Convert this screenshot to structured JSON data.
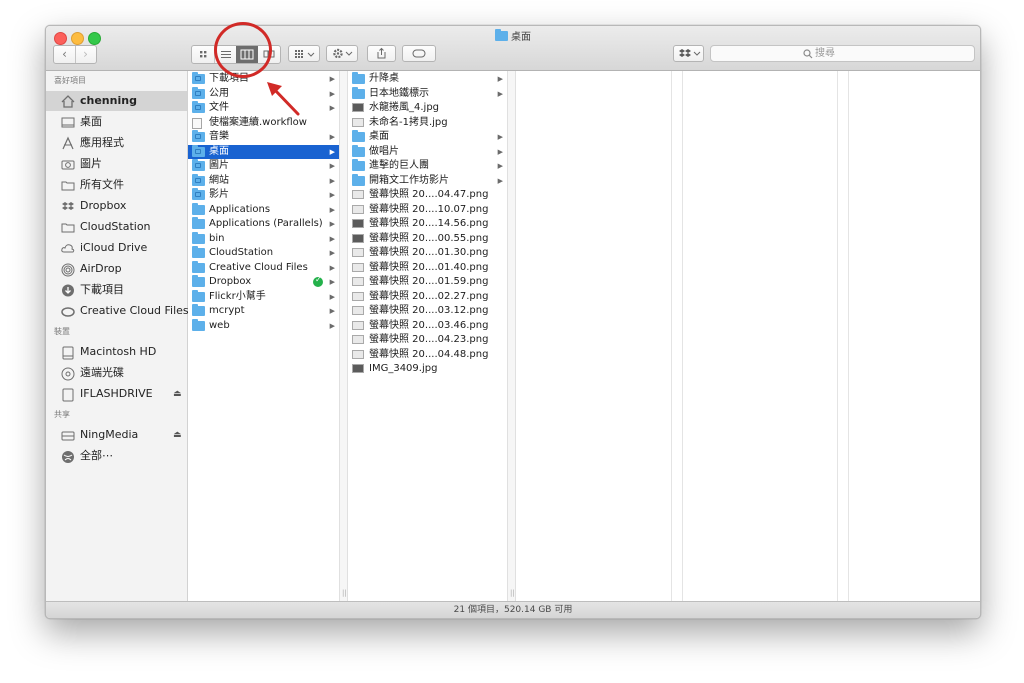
{
  "window": {
    "title": "桌面"
  },
  "toolbar": {
    "search_placeholder": "搜尋"
  },
  "sidebar": {
    "sections": [
      {
        "header": "喜好項目",
        "items": [
          {
            "label": "chenning",
            "icon": "home-icon",
            "selected": true
          },
          {
            "label": "桌面",
            "icon": "desktop-icon"
          },
          {
            "label": "應用程式",
            "icon": "applications-icon"
          },
          {
            "label": "圖片",
            "icon": "camera-icon"
          },
          {
            "label": "所有文件",
            "icon": "folder-icon"
          },
          {
            "label": "Dropbox",
            "icon": "dropbox-icon"
          },
          {
            "label": "CloudStation",
            "icon": "folder-icon"
          },
          {
            "label": "iCloud Drive",
            "icon": "cloud-icon"
          },
          {
            "label": "AirDrop",
            "icon": "airdrop-icon"
          },
          {
            "label": "下載項目",
            "icon": "download-icon"
          },
          {
            "label": "Creative Cloud Files",
            "icon": "creative-cloud-icon"
          }
        ]
      },
      {
        "header": "裝置",
        "items": [
          {
            "label": "Macintosh HD",
            "icon": "hard-drive-icon"
          },
          {
            "label": "遠端光碟",
            "icon": "disc-icon"
          },
          {
            "label": "IFLASHDRIVE",
            "icon": "usb-drive-icon",
            "eject": "⏏"
          }
        ]
      },
      {
        "header": "共享",
        "items": [
          {
            "label": "NingMedia",
            "icon": "network-server-icon",
            "eject": "⏏"
          },
          {
            "label": "全部⋯",
            "icon": "network-globe-icon"
          }
        ]
      }
    ]
  },
  "column1": [
    {
      "name": "下載項目",
      "icon": "folder-badge",
      "arrow": true
    },
    {
      "name": "公用",
      "icon": "folder-badge",
      "arrow": true
    },
    {
      "name": "文件",
      "icon": "folder-badge",
      "arrow": true
    },
    {
      "name": "使檔案連續.workflow",
      "icon": "doc",
      "arrow": false
    },
    {
      "name": "音樂",
      "icon": "folder-badge",
      "arrow": true
    },
    {
      "name": "桌面",
      "icon": "folder-badge",
      "arrow": true,
      "selected": true
    },
    {
      "name": "圖片",
      "icon": "folder-badge",
      "arrow": true
    },
    {
      "name": "網站",
      "icon": "folder-badge",
      "arrow": true
    },
    {
      "name": "影片",
      "icon": "folder-badge",
      "arrow": true
    },
    {
      "name": "Applications",
      "icon": "folder",
      "arrow": true
    },
    {
      "name": "Applications (Parallels)",
      "icon": "folder",
      "arrow": true
    },
    {
      "name": "bin",
      "icon": "folder",
      "arrow": true
    },
    {
      "name": "CloudStation",
      "icon": "folder",
      "arrow": true
    },
    {
      "name": "Creative Cloud Files",
      "icon": "folder",
      "arrow": true
    },
    {
      "name": "Dropbox",
      "icon": "folder",
      "arrow": true,
      "synced": true
    },
    {
      "name": "Flickr小幫手",
      "icon": "folder",
      "arrow": true
    },
    {
      "name": "mcrypt",
      "icon": "folder",
      "arrow": true
    },
    {
      "name": "web",
      "icon": "folder",
      "arrow": true
    }
  ],
  "column2": [
    {
      "name": "升降桌",
      "icon": "folder",
      "arrow": true
    },
    {
      "name": "日本地鐵標示",
      "icon": "folder",
      "arrow": true
    },
    {
      "name": "水龍捲風_4.jpg",
      "icon": "shot-dark",
      "arrow": false
    },
    {
      "name": "未命名-1拷貝.jpg",
      "icon": "shot",
      "arrow": false
    },
    {
      "name": "桌面",
      "icon": "folder",
      "arrow": true
    },
    {
      "name": "做唱片",
      "icon": "folder",
      "arrow": true
    },
    {
      "name": "進擊的巨人團",
      "icon": "folder",
      "arrow": true
    },
    {
      "name": "開箱文工作坊影片",
      "icon": "folder",
      "arrow": true
    },
    {
      "name": "螢幕快照 20....04.47.png",
      "icon": "shot",
      "arrow": false
    },
    {
      "name": "螢幕快照 20....10.07.png",
      "icon": "shot",
      "arrow": false
    },
    {
      "name": "螢幕快照 20....14.56.png",
      "icon": "shot-dark",
      "arrow": false
    },
    {
      "name": "螢幕快照 20....00.55.png",
      "icon": "shot-dark",
      "arrow": false
    },
    {
      "name": "螢幕快照 20....01.30.png",
      "icon": "shot",
      "arrow": false
    },
    {
      "name": "螢幕快照 20....01.40.png",
      "icon": "shot",
      "arrow": false
    },
    {
      "name": "螢幕快照 20....01.59.png",
      "icon": "shot",
      "arrow": false
    },
    {
      "name": "螢幕快照 20....02.27.png",
      "icon": "shot",
      "arrow": false
    },
    {
      "name": "螢幕快照 20....03.12.png",
      "icon": "shot",
      "arrow": false
    },
    {
      "name": "螢幕快照 20....03.46.png",
      "icon": "shot",
      "arrow": false
    },
    {
      "name": "螢幕快照 20....04.23.png",
      "icon": "shot",
      "arrow": false
    },
    {
      "name": "螢幕快照 20....04.48.png",
      "icon": "shot",
      "arrow": false
    },
    {
      "name": "IMG_3409.jpg",
      "icon": "shot-dark",
      "arrow": false
    }
  ],
  "status": {
    "text": "21 個項目，520.14 GB 可用"
  },
  "colors": {
    "selection": "#1963d1",
    "folder": "#5db0ea",
    "annotation": "#d12a27"
  }
}
